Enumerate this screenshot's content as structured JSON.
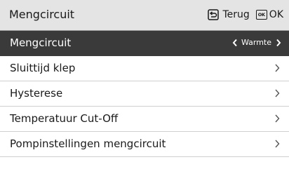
{
  "header": {
    "title": "Mengcircuit",
    "back_label": "Terug",
    "back_icon": "return-arrow-icon",
    "ok_icon_text": "OK",
    "ok_label": "OK"
  },
  "menu": {
    "items": [
      {
        "label": "Mengcircuit",
        "value": "Warmte",
        "selected": true
      },
      {
        "label": "Sluittijd klep"
      },
      {
        "label": "Hysterese"
      },
      {
        "label": "Temperatuur Cut-Off"
      },
      {
        "label": "Pompinstellingen mengcircuit"
      }
    ]
  },
  "colors": {
    "header_bg": "#e4e4e4",
    "selected_bg": "#3a3a3a",
    "text": "#1a1a1a",
    "divider": "#cfcfcf"
  }
}
